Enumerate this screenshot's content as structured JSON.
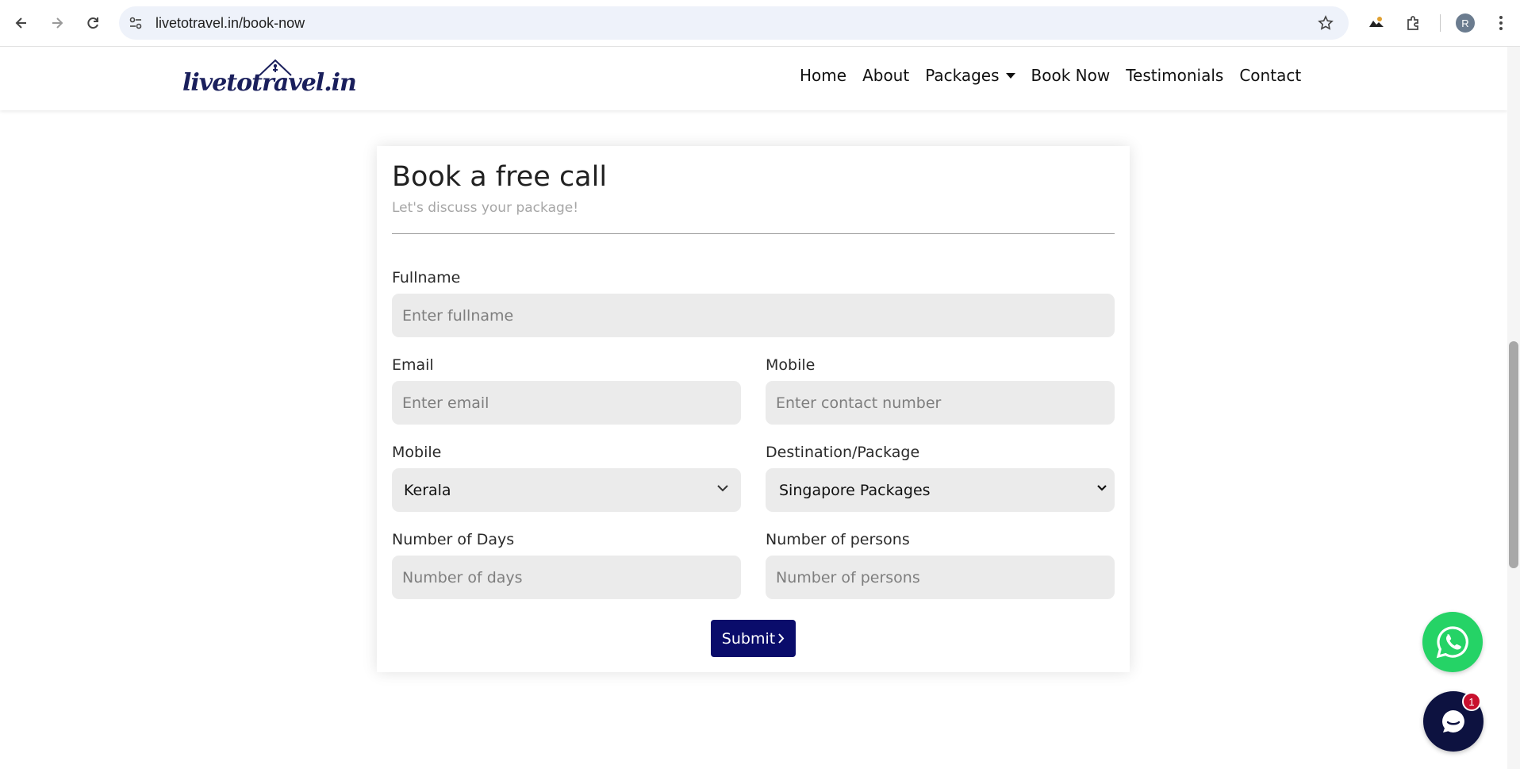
{
  "browser": {
    "url": "livetotravel.in/book-now",
    "profile_initial": "R"
  },
  "site": {
    "logo_text": "livetotravel.in",
    "nav": [
      {
        "label": "Home"
      },
      {
        "label": "About"
      },
      {
        "label": "Packages"
      },
      {
        "label": "Book Now"
      },
      {
        "label": "Testimonials"
      },
      {
        "label": "Contact"
      }
    ]
  },
  "form": {
    "title": "Book a free call",
    "subtitle": "Let's discuss your package!",
    "fullname": {
      "label": "Fullname",
      "placeholder": "Enter fullname"
    },
    "email": {
      "label": "Email",
      "placeholder": "Enter email"
    },
    "mobile": {
      "label": "Mobile",
      "placeholder": "Enter contact number"
    },
    "state": {
      "label": "Mobile",
      "value": "Kerala"
    },
    "destination": {
      "label": "Destination/Package",
      "value": "Singapore Packages"
    },
    "days": {
      "label": "Number of Days",
      "placeholder": "Number of days"
    },
    "persons": {
      "label": "Number of persons",
      "placeholder": "Number of persons"
    },
    "submit_label": "Submit"
  },
  "widgets": {
    "chat_badge": "1"
  },
  "colors": {
    "brand": "#0a0c6b",
    "whatsapp": "#25d366",
    "chat": "#0d1240",
    "badge": "#c8102e"
  }
}
